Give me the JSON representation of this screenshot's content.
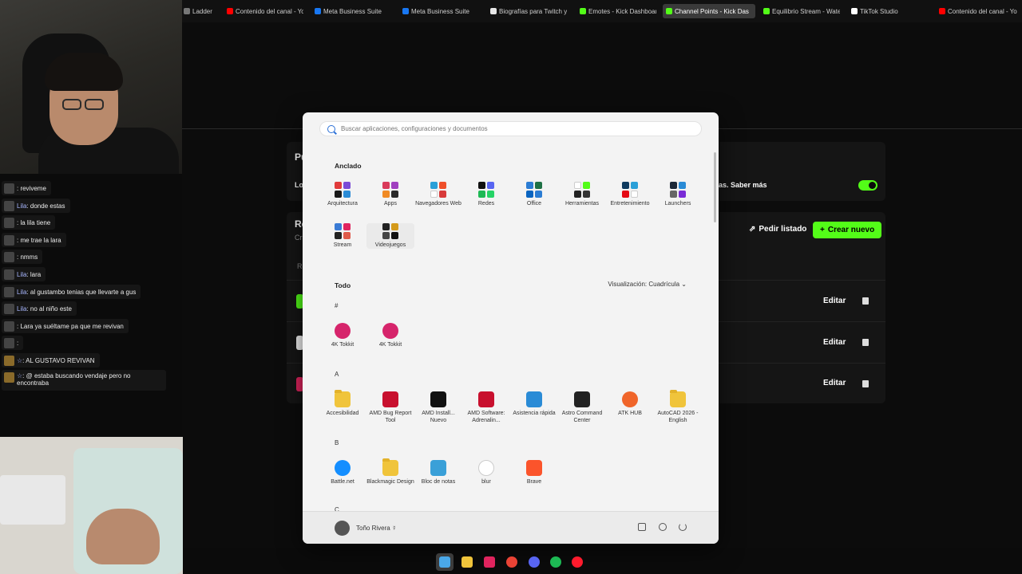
{
  "tabs": [
    {
      "label": "Ladder",
      "color": "#777"
    },
    {
      "label": "Contenido del canal - Yo",
      "color": "#ff0000"
    },
    {
      "label": "Meta Business Suite",
      "color": "#1877f2"
    },
    {
      "label": "Meta Business Suite",
      "color": "#1877f2"
    },
    {
      "label": "Biografías para Twitch y",
      "color": "#e6e6e6"
    },
    {
      "label": "Emotes - Kick Dashboar",
      "color": "#53fc18"
    },
    {
      "label": "Channel Points - Kick Das",
      "color": "#53fc18"
    },
    {
      "label": "Equilibrio Stream - Wate",
      "color": "#53fc18"
    },
    {
      "label": "TikTok Studio",
      "color": "#ffffff"
    },
    {
      "label": "Contenido del canal - Yo",
      "color": "#ff0000"
    }
  ],
  "background_page": {
    "title1": "Pu",
    "row1_label": "Lo",
    "row1_right": "as. Saber más",
    "title2": "Re",
    "subtitle2": "Cr",
    "col_label": "Re",
    "pedir_listado": "Pedir listado",
    "crear_nuevo": "Crear nuevo",
    "edit_label": "Editar",
    "accent": "#53fc18"
  },
  "chat": [
    {
      "user": "",
      "text": ": reviveme"
    },
    {
      "user": "Lila",
      "text": ": donde estas"
    },
    {
      "user": "",
      "text": ": la lila tiene"
    },
    {
      "user": "",
      "text": ": me trae la lara"
    },
    {
      "user": "",
      "text": ": nmms"
    },
    {
      "user": "Lila",
      "text": ": lara"
    },
    {
      "user": "Lila",
      "text": ": al gustambo tenias que llevarte a gus"
    },
    {
      "user": "Lila",
      "text": ": no al niño este"
    },
    {
      "user": "",
      "text": ": Lara ya suéltame pa que me revivan"
    },
    {
      "user": "",
      "text": ":"
    },
    {
      "user": "☆",
      "text": ": AL GUSTAVO REVIVAN"
    },
    {
      "user": "☆",
      "text": ": @ estaba buscando vendaje pero no encontraba"
    }
  ],
  "start_menu": {
    "search_placeholder": "Buscar aplicaciones, configuraciones y documentos",
    "pinned_title": "Anclado",
    "pinned": [
      {
        "label": "Arquitectura",
        "colors": [
          "#e13b3b",
          "#7a4bd6",
          "#1a1a1a",
          "#2a8bd6"
        ]
      },
      {
        "label": "Apps",
        "colors": [
          "#d93a5a",
          "#a040c0",
          "#f08a24",
          "#2a2a2a"
        ]
      },
      {
        "label": "Navegadores Web",
        "colors": [
          "#2aa0d8",
          "#ef4f2a",
          "#ffffff",
          "#d83a3a"
        ]
      },
      {
        "label": "Redes",
        "colors": [
          "#111111",
          "#5865f2",
          "#1db954",
          "#25d366"
        ]
      },
      {
        "label": "Office",
        "colors": [
          "#2b7cd3",
          "#1e7145",
          "#0a64c0",
          "#2b7cd3"
        ]
      },
      {
        "label": "Herramientas",
        "colors": [
          "#ffffff",
          "#53fc18",
          "#222222",
          "#333333"
        ]
      },
      {
        "label": "Entretenimiento",
        "colors": [
          "#0f3b5f",
          "#2aa0d8",
          "#e50914",
          "#ffffff"
        ]
      },
      {
        "label": "Launchers",
        "colors": [
          "#1b2838",
          "#2a8bd6",
          "#666666",
          "#7a2bd6"
        ]
      },
      {
        "label": "Stream",
        "colors": [
          "#3a7bd5",
          "#e0245e",
          "#222222",
          "#e05a4a"
        ]
      },
      {
        "label": "Videojuegos",
        "colors": [
          "#222222",
          "#d49a1a",
          "#444444",
          "#111111"
        ]
      }
    ],
    "all_title": "Todo",
    "view_label": "Visualización: Cuadrícula",
    "groups": [
      {
        "letter": "#",
        "apps": [
          {
            "label": "4K Tokkit",
            "icon": "tokkit-icon",
            "color": "#d6246b"
          },
          {
            "label": "4K Tokkit",
            "icon": "tokkit-icon",
            "color": "#d6246b"
          }
        ]
      },
      {
        "letter": "A",
        "apps": [
          {
            "label": "Accesibilidad",
            "icon": "folder-icon",
            "color": "#f0c43b"
          },
          {
            "label": "AMD Bug Report Tool",
            "icon": "amd-icon",
            "color": "#c8102e"
          },
          {
            "label": "AMD Install... Nuevo",
            "icon": "amd-icon",
            "color": "#111111"
          },
          {
            "label": "AMD Software: Adrenalin...",
            "icon": "amd-icon",
            "color": "#c8102e"
          },
          {
            "label": "Asistencia rápida",
            "icon": "monitor-icon",
            "color": "#2a8bd6"
          },
          {
            "label": "Astro Command Center",
            "icon": "astro-icon",
            "color": "#222222"
          },
          {
            "label": "ATK HUB",
            "icon": "atk-icon",
            "color": "#f0652a"
          },
          {
            "label": "AutoCAD 2026 - English",
            "icon": "folder-icon",
            "color": "#f0c43b"
          }
        ]
      },
      {
        "letter": "B",
        "apps": [
          {
            "label": "Battle.net",
            "icon": "battlenet-icon",
            "color": "#148eff"
          },
          {
            "label": "Blackmagic Design",
            "icon": "folder-icon",
            "color": "#f0c43b"
          },
          {
            "label": "Bloc de notas",
            "icon": "notepad-icon",
            "color": "#3aa0d8"
          },
          {
            "label": "blur",
            "icon": "blur-icon",
            "color": "#ffffff"
          },
          {
            "label": "Brave",
            "icon": "brave-icon",
            "color": "#fb542b"
          }
        ]
      },
      {
        "letter": "C",
        "apps": []
      }
    ],
    "user_name": "Toño Rivera ☿"
  },
  "taskbar": [
    {
      "name": "windows-start-icon",
      "color": "#4aa8e8"
    },
    {
      "name": "file-explorer-icon",
      "color": "#f0c43b"
    },
    {
      "name": "stream-app-icon",
      "color": "#e0245e"
    },
    {
      "name": "chrome-icon",
      "color": "#ea4335"
    },
    {
      "name": "discord-icon",
      "color": "#5865f2"
    },
    {
      "name": "spotify-icon",
      "color": "#1db954"
    },
    {
      "name": "opera-icon",
      "color": "#ff1b2d"
    }
  ]
}
